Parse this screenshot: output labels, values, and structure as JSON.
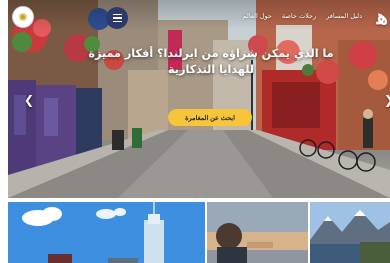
{
  "nav": {
    "links": [
      "حول العالم",
      "رحلات خاصة",
      "دليل المسافر"
    ],
    "brand_mark": "ﻫ"
  },
  "hero": {
    "headline": "ما الذي يمكن شراؤه من ايرلندا؟ أفكار مميزة للهدايا التذكارية",
    "cta_label": "ابحث عن المغامرة",
    "prev_icon": "chevron-left-icon",
    "next_icon": "chevron-right-icon"
  },
  "cards": [
    {
      "icon": "city-tower-image"
    },
    {
      "icon": "sunset-person-image"
    },
    {
      "icon": "mountain-lake-image"
    }
  ],
  "colors": {
    "accent_yellow": "#f6c53a",
    "menu_navy": "#2c3a6b",
    "sky_blue": "#3f8fe0"
  }
}
